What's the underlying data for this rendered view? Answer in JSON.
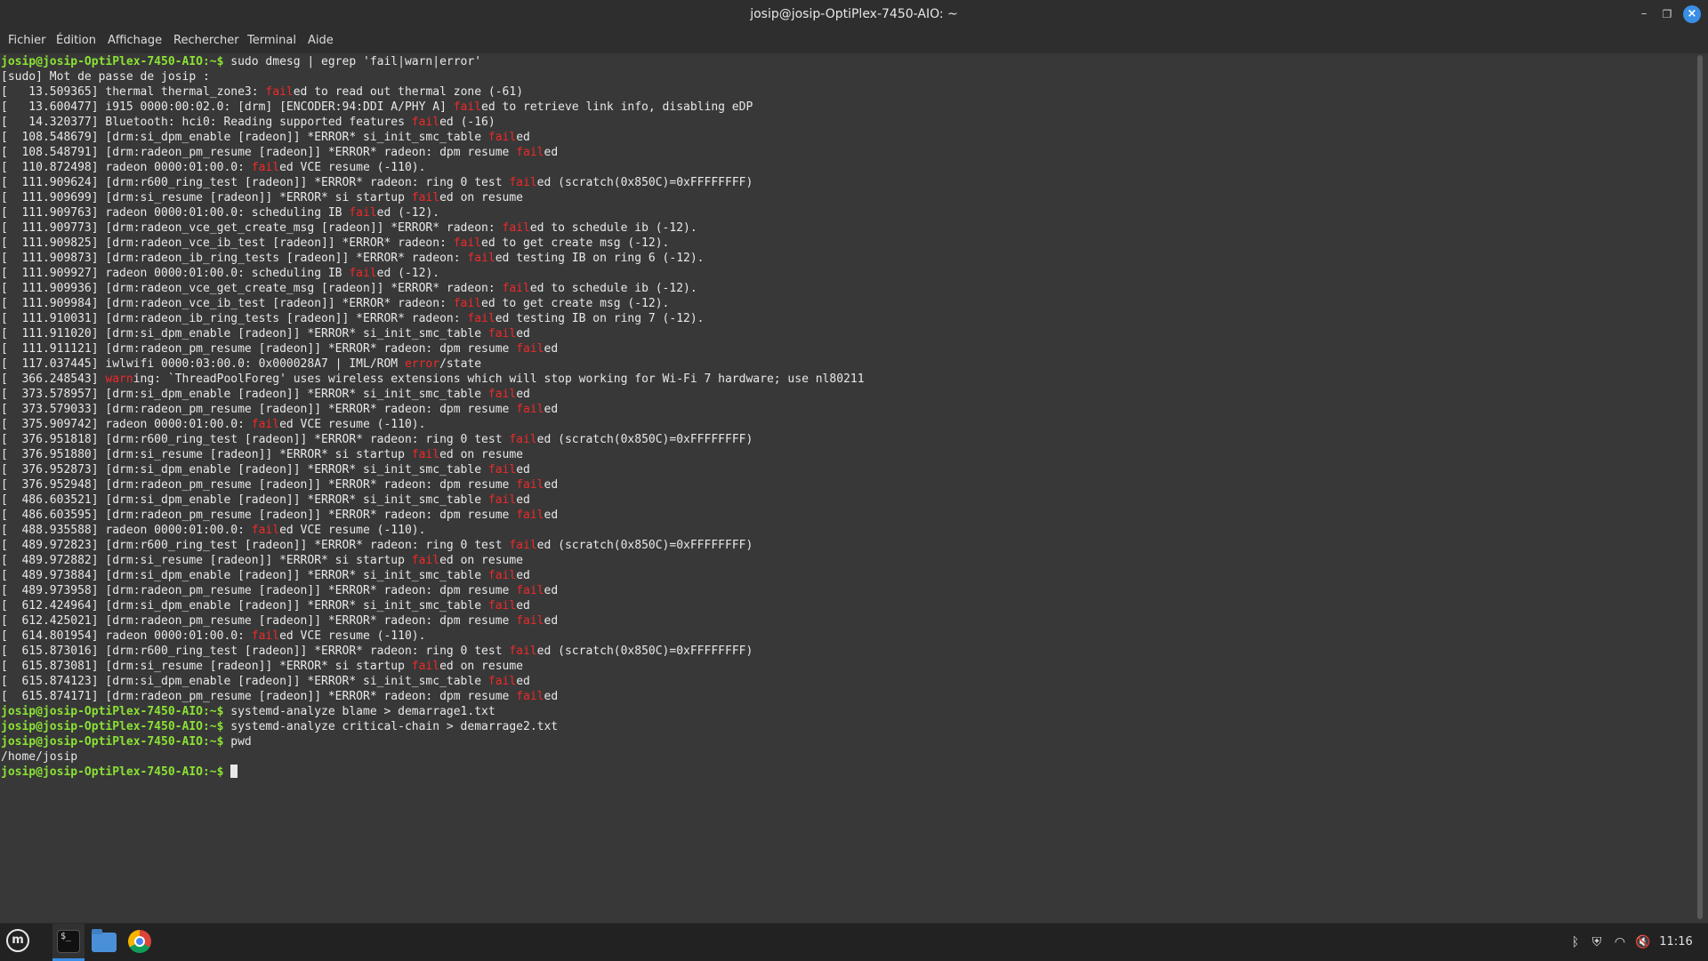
{
  "window": {
    "title": "josip@josip-OptiPlex-7450-AIO: ~"
  },
  "menu": [
    "Fichier",
    "Édition",
    "Affichage",
    "Rechercher",
    "Terminal",
    "Aide"
  ],
  "colors": {
    "prompt": "#8ae234",
    "highlight": "#ef2929",
    "background": "#383838",
    "accent": "#3a8ee6"
  },
  "prompt": "josip@josip-OptiPlex-7450-AIO:~$",
  "terminal_lines": [
    {
      "type": "cmd",
      "text": " sudo dmesg | egrep 'fail|warn|error'"
    },
    {
      "type": "out",
      "parts": [
        "[sudo] Mot de passe de josip : "
      ]
    },
    {
      "type": "out",
      "parts": [
        "[   13.509365] thermal thermal_zone3: ",
        {
          "hl": "fail"
        },
        "ed to read out thermal zone (-61)"
      ]
    },
    {
      "type": "out",
      "parts": [
        "[   13.600477] i915 0000:00:02.0: [drm] [ENCODER:94:DDI A/PHY A] ",
        {
          "hl": "fail"
        },
        "ed to retrieve link info, disabling eDP"
      ]
    },
    {
      "type": "out",
      "parts": [
        "[   14.320377] Bluetooth: hci0: Reading supported features ",
        {
          "hl": "fail"
        },
        "ed (-16)"
      ]
    },
    {
      "type": "out",
      "parts": [
        "[  108.548679] [drm:si_dpm_enable [radeon]] *ERROR* si_init_smc_table ",
        {
          "hl": "fail"
        },
        "ed"
      ]
    },
    {
      "type": "out",
      "parts": [
        "[  108.548791] [drm:radeon_pm_resume [radeon]] *ERROR* radeon: dpm resume ",
        {
          "hl": "fail"
        },
        "ed"
      ]
    },
    {
      "type": "out",
      "parts": [
        "[  110.872498] radeon 0000:01:00.0: ",
        {
          "hl": "fail"
        },
        "ed VCE resume (-110)."
      ]
    },
    {
      "type": "out",
      "parts": [
        "[  111.909624] [drm:r600_ring_test [radeon]] *ERROR* radeon: ring 0 test ",
        {
          "hl": "fail"
        },
        "ed (scratch(0x850C)=0xFFFFFFFF)"
      ]
    },
    {
      "type": "out",
      "parts": [
        "[  111.909699] [drm:si_resume [radeon]] *ERROR* si startup ",
        {
          "hl": "fail"
        },
        "ed on resume"
      ]
    },
    {
      "type": "out",
      "parts": [
        "[  111.909763] radeon 0000:01:00.0: scheduling IB ",
        {
          "hl": "fail"
        },
        "ed (-12)."
      ]
    },
    {
      "type": "out",
      "parts": [
        "[  111.909773] [drm:radeon_vce_get_create_msg [radeon]] *ERROR* radeon: ",
        {
          "hl": "fail"
        },
        "ed to schedule ib (-12)."
      ]
    },
    {
      "type": "out",
      "parts": [
        "[  111.909825] [drm:radeon_vce_ib_test [radeon]] *ERROR* radeon: ",
        {
          "hl": "fail"
        },
        "ed to get create msg (-12)."
      ]
    },
    {
      "type": "out",
      "parts": [
        "[  111.909873] [drm:radeon_ib_ring_tests [radeon]] *ERROR* radeon: ",
        {
          "hl": "fail"
        },
        "ed testing IB on ring 6 (-12)."
      ]
    },
    {
      "type": "out",
      "parts": [
        "[  111.909927] radeon 0000:01:00.0: scheduling IB ",
        {
          "hl": "fail"
        },
        "ed (-12)."
      ]
    },
    {
      "type": "out",
      "parts": [
        "[  111.909936] [drm:radeon_vce_get_create_msg [radeon]] *ERROR* radeon: ",
        {
          "hl": "fail"
        },
        "ed to schedule ib (-12)."
      ]
    },
    {
      "type": "out",
      "parts": [
        "[  111.909984] [drm:radeon_vce_ib_test [radeon]] *ERROR* radeon: ",
        {
          "hl": "fail"
        },
        "ed to get create msg (-12)."
      ]
    },
    {
      "type": "out",
      "parts": [
        "[  111.910031] [drm:radeon_ib_ring_tests [radeon]] *ERROR* radeon: ",
        {
          "hl": "fail"
        },
        "ed testing IB on ring 7 (-12)."
      ]
    },
    {
      "type": "out",
      "parts": [
        "[  111.911020] [drm:si_dpm_enable [radeon]] *ERROR* si_init_smc_table ",
        {
          "hl": "fail"
        },
        "ed"
      ]
    },
    {
      "type": "out",
      "parts": [
        "[  111.911121] [drm:radeon_pm_resume [radeon]] *ERROR* radeon: dpm resume ",
        {
          "hl": "fail"
        },
        "ed"
      ]
    },
    {
      "type": "out",
      "parts": [
        "[  117.037445] iwlwifi 0000:03:00.0: 0x000028A7 | IML/ROM ",
        {
          "hl": "error"
        },
        "/state"
      ]
    },
    {
      "type": "out",
      "parts": [
        "[  366.248543] ",
        {
          "hl": "warn"
        },
        "ing: `ThreadPoolForeg' uses wireless extensions which will stop working for Wi-Fi 7 hardware; use nl80211"
      ]
    },
    {
      "type": "out",
      "parts": [
        "[  373.578957] [drm:si_dpm_enable [radeon]] *ERROR* si_init_smc_table ",
        {
          "hl": "fail"
        },
        "ed"
      ]
    },
    {
      "type": "out",
      "parts": [
        "[  373.579033] [drm:radeon_pm_resume [radeon]] *ERROR* radeon: dpm resume ",
        {
          "hl": "fail"
        },
        "ed"
      ]
    },
    {
      "type": "out",
      "parts": [
        "[  375.909742] radeon 0000:01:00.0: ",
        {
          "hl": "fail"
        },
        "ed VCE resume (-110)."
      ]
    },
    {
      "type": "out",
      "parts": [
        "[  376.951818] [drm:r600_ring_test [radeon]] *ERROR* radeon: ring 0 test ",
        {
          "hl": "fail"
        },
        "ed (scratch(0x850C)=0xFFFFFFFF)"
      ]
    },
    {
      "type": "out",
      "parts": [
        "[  376.951880] [drm:si_resume [radeon]] *ERROR* si startup ",
        {
          "hl": "fail"
        },
        "ed on resume"
      ]
    },
    {
      "type": "out",
      "parts": [
        "[  376.952873] [drm:si_dpm_enable [radeon]] *ERROR* si_init_smc_table ",
        {
          "hl": "fail"
        },
        "ed"
      ]
    },
    {
      "type": "out",
      "parts": [
        "[  376.952948] [drm:radeon_pm_resume [radeon]] *ERROR* radeon: dpm resume ",
        {
          "hl": "fail"
        },
        "ed"
      ]
    },
    {
      "type": "out",
      "parts": [
        "[  486.603521] [drm:si_dpm_enable [radeon]] *ERROR* si_init_smc_table ",
        {
          "hl": "fail"
        },
        "ed"
      ]
    },
    {
      "type": "out",
      "parts": [
        "[  486.603595] [drm:radeon_pm_resume [radeon]] *ERROR* radeon: dpm resume ",
        {
          "hl": "fail"
        },
        "ed"
      ]
    },
    {
      "type": "out",
      "parts": [
        "[  488.935588] radeon 0000:01:00.0: ",
        {
          "hl": "fail"
        },
        "ed VCE resume (-110)."
      ]
    },
    {
      "type": "out",
      "parts": [
        "[  489.972823] [drm:r600_ring_test [radeon]] *ERROR* radeon: ring 0 test ",
        {
          "hl": "fail"
        },
        "ed (scratch(0x850C)=0xFFFFFFFF)"
      ]
    },
    {
      "type": "out",
      "parts": [
        "[  489.972882] [drm:si_resume [radeon]] *ERROR* si startup ",
        {
          "hl": "fail"
        },
        "ed on resume"
      ]
    },
    {
      "type": "out",
      "parts": [
        "[  489.973884] [drm:si_dpm_enable [radeon]] *ERROR* si_init_smc_table ",
        {
          "hl": "fail"
        },
        "ed"
      ]
    },
    {
      "type": "out",
      "parts": [
        "[  489.973958] [drm:radeon_pm_resume [radeon]] *ERROR* radeon: dpm resume ",
        {
          "hl": "fail"
        },
        "ed"
      ]
    },
    {
      "type": "out",
      "parts": [
        "[  612.424964] [drm:si_dpm_enable [radeon]] *ERROR* si_init_smc_table ",
        {
          "hl": "fail"
        },
        "ed"
      ]
    },
    {
      "type": "out",
      "parts": [
        "[  612.425021] [drm:radeon_pm_resume [radeon]] *ERROR* radeon: dpm resume ",
        {
          "hl": "fail"
        },
        "ed"
      ]
    },
    {
      "type": "out",
      "parts": [
        "[  614.801954] radeon 0000:01:00.0: ",
        {
          "hl": "fail"
        },
        "ed VCE resume (-110)."
      ]
    },
    {
      "type": "out",
      "parts": [
        "[  615.873016] [drm:r600_ring_test [radeon]] *ERROR* radeon: ring 0 test ",
        {
          "hl": "fail"
        },
        "ed (scratch(0x850C)=0xFFFFFFFF)"
      ]
    },
    {
      "type": "out",
      "parts": [
        "[  615.873081] [drm:si_resume [radeon]] *ERROR* si startup ",
        {
          "hl": "fail"
        },
        "ed on resume"
      ]
    },
    {
      "type": "out",
      "parts": [
        "[  615.874123] [drm:si_dpm_enable [radeon]] *ERROR* si_init_smc_table ",
        {
          "hl": "fail"
        },
        "ed"
      ]
    },
    {
      "type": "out",
      "parts": [
        "[  615.874171] [drm:radeon_pm_resume [radeon]] *ERROR* radeon: dpm resume ",
        {
          "hl": "fail"
        },
        "ed"
      ]
    },
    {
      "type": "cmd",
      "text": " systemd-analyze blame > demarrage1.txt"
    },
    {
      "type": "cmd",
      "text": " systemd-analyze critical-chain > demarrage2.txt"
    },
    {
      "type": "cmd",
      "text": " pwd"
    },
    {
      "type": "out",
      "parts": [
        "/home/josip"
      ]
    },
    {
      "type": "cmd",
      "text": " ",
      "cursor": true
    }
  ],
  "taskbar": {
    "menu_icon": "linux-mint-logo-icon",
    "mint_glyph": "m",
    "term_glyph": "$_",
    "apps": [
      {
        "name": "terminal-icon",
        "active": true
      },
      {
        "name": "files-folder-icon",
        "active": false
      },
      {
        "name": "chrome-browser-icon",
        "active": false
      }
    ],
    "tray_glyphs": {
      "bluetooth": "ᛒ",
      "shield": "⛨",
      "wifi": "◠",
      "volume": "🔇"
    },
    "clock": "11:16"
  }
}
